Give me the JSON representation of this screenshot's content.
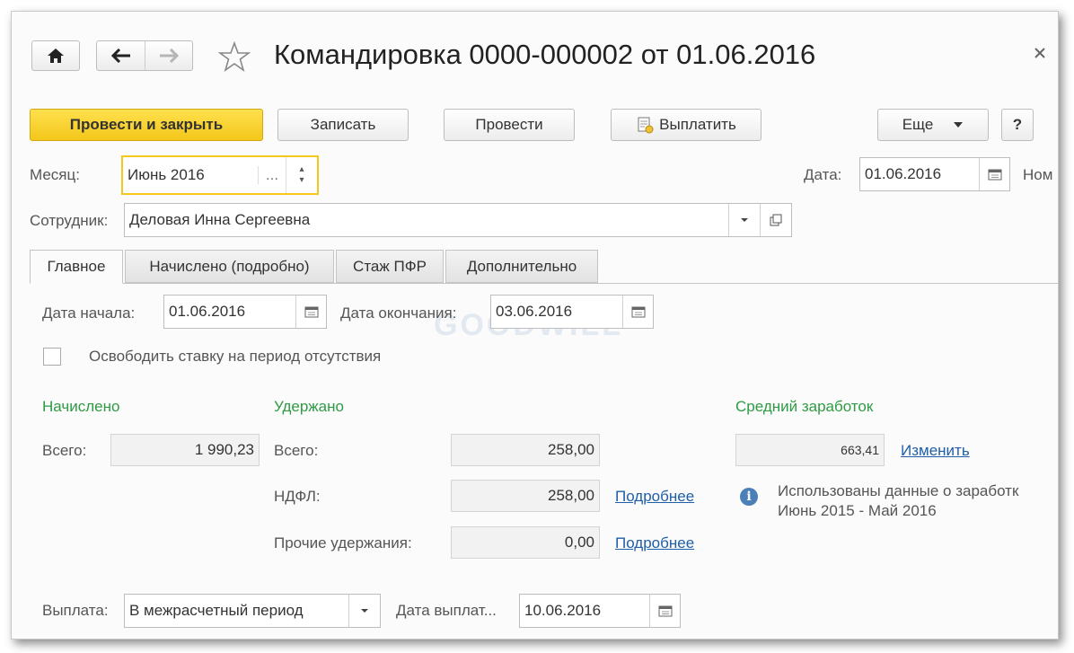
{
  "nav": {
    "home_icon": "home-icon",
    "back_icon": "arrow-left-icon",
    "forward_icon": "arrow-right-icon",
    "star_icon": "star-icon",
    "close_icon": "close-icon"
  },
  "title": "Командировка 0000-000002 от 01.06.2016",
  "toolbar": {
    "post_close": "Провести и закрыть",
    "save": "Записать",
    "post": "Провести",
    "pay": "Выплатить",
    "more": "Еще",
    "help": "?"
  },
  "header": {
    "month_label": "Месяц:",
    "month_value": "Июнь 2016",
    "month_dots": "...",
    "date_label": "Дата:",
    "date_value": "01.06.2016",
    "number_label": "Ном",
    "employee_label": "Сотрудник:",
    "employee_value": "Деловая Инна Сергеевна"
  },
  "tabs": [
    "Главное",
    "Начислено (подробно)",
    "Стаж ПФР",
    "Дополнительно"
  ],
  "main": {
    "start_label": "Дата начала:",
    "start_value": "01.06.2016",
    "end_label": "Дата окончания:",
    "end_value": "03.06.2016",
    "release_rate_label": "Освободить ставку на период отсутствия",
    "accrued_title": "Начислено",
    "accrued_total_label": "Всего:",
    "accrued_total_value": "1 990,23",
    "withheld_title": "Удержано",
    "withheld_total_label": "Всего:",
    "withheld_total_value": "258,00",
    "ndfl_label": "НДФЛ:",
    "ndfl_value": "258,00",
    "ndfl_link": "Подробнее",
    "other_label": "Прочие удержания:",
    "other_value": "0,00",
    "other_link": "Подробнее",
    "avg_title": "Средний заработок",
    "avg_value": "663,41",
    "avg_link": "Изменить",
    "info_line1": "Использованы данные о заработк",
    "info_line2": "Июнь 2015 - Май 2016",
    "payout_label": "Выплата:",
    "payout_value": "В межрасчетный период",
    "pay_date_label": "Дата выплат...",
    "pay_date_value": "10.06.2016",
    "watermark": "GOODWILL"
  },
  "colors": {
    "primary": "#f7d02c",
    "accent_green": "#2e9b44",
    "link": "#1f5fa7"
  }
}
